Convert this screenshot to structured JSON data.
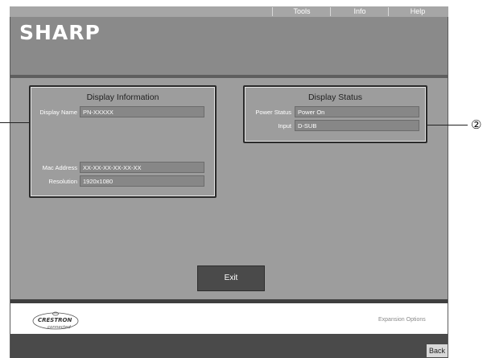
{
  "menu": {
    "tools_label": "Tools",
    "info_label": "Info",
    "help_label": "Help"
  },
  "brand": {
    "logo_text": "SHARP"
  },
  "display_information": {
    "title": "Display Information",
    "display_name_label": "Display Name",
    "display_name_value": "PN-XXXXX",
    "mac_address_label": "Mac Address",
    "mac_address_value": "XX-XX-XX-XX-XX-XX",
    "resolution_label": "Resolution",
    "resolution_value": "1920x1080"
  },
  "display_status": {
    "title": "Display Status",
    "power_status_label": "Power Status",
    "power_status_value": "Power On",
    "input_label": "Input",
    "input_value": "D-SUB"
  },
  "actions": {
    "exit_label": "Exit",
    "back_label": "Back"
  },
  "footer": {
    "crestron_brand": "CRESTRON",
    "crestron_tagline": "connected",
    "expansion_options_label": "Expansion Options"
  },
  "callouts": {
    "status_callout": "②"
  }
}
